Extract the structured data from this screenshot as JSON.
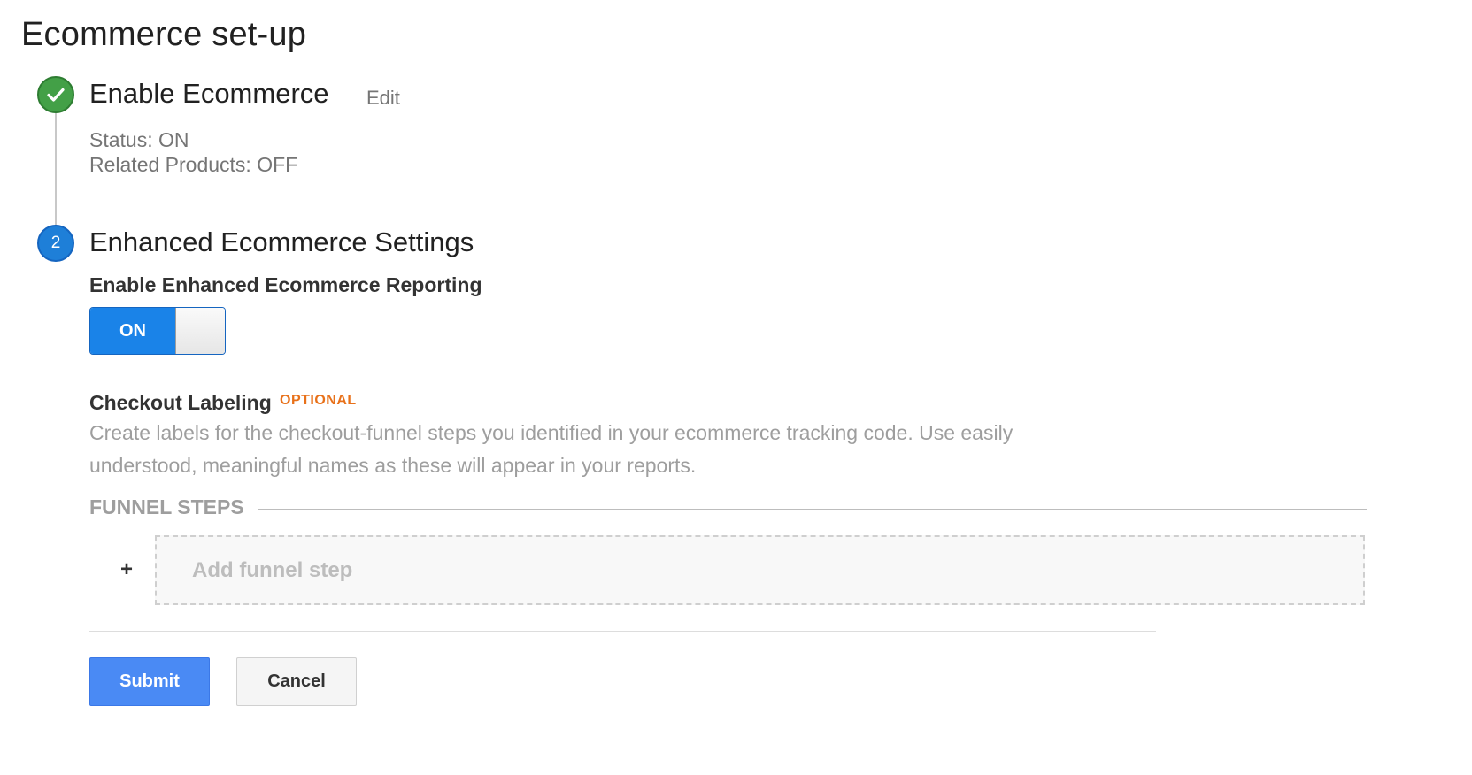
{
  "page": {
    "title": "Ecommerce set-up"
  },
  "step1": {
    "title": "Enable Ecommerce",
    "edit_label": "Edit",
    "status_line": "Status: ON",
    "related_products_line": "Related Products: OFF",
    "badge_icon": "checkmark-icon",
    "badge_color": "#43a047"
  },
  "step2": {
    "number": "2",
    "title": "Enhanced Ecommerce Settings",
    "badge_color": "#1e7fd8",
    "reporting_label": "Enable Enhanced Ecommerce Reporting",
    "toggle_label": "ON",
    "toggle_state": "on",
    "checkout_label": "Checkout Labeling",
    "optional_tag": "OPTIONAL",
    "description": "Create labels for the checkout-funnel steps you identified in your ecommerce tracking code. Use easily understood, meaningful names as these will appear in your reports.",
    "funnel_header": "FUNNEL STEPS",
    "add_step_icon": "plus-icon",
    "add_step_symbol": "+",
    "add_step_label": "Add funnel step"
  },
  "actions": {
    "submit_label": "Submit",
    "cancel_label": "Cancel"
  },
  "colors": {
    "accent": "#1a83e8",
    "submit": "#4a8af4",
    "optional": "#e8711a"
  }
}
